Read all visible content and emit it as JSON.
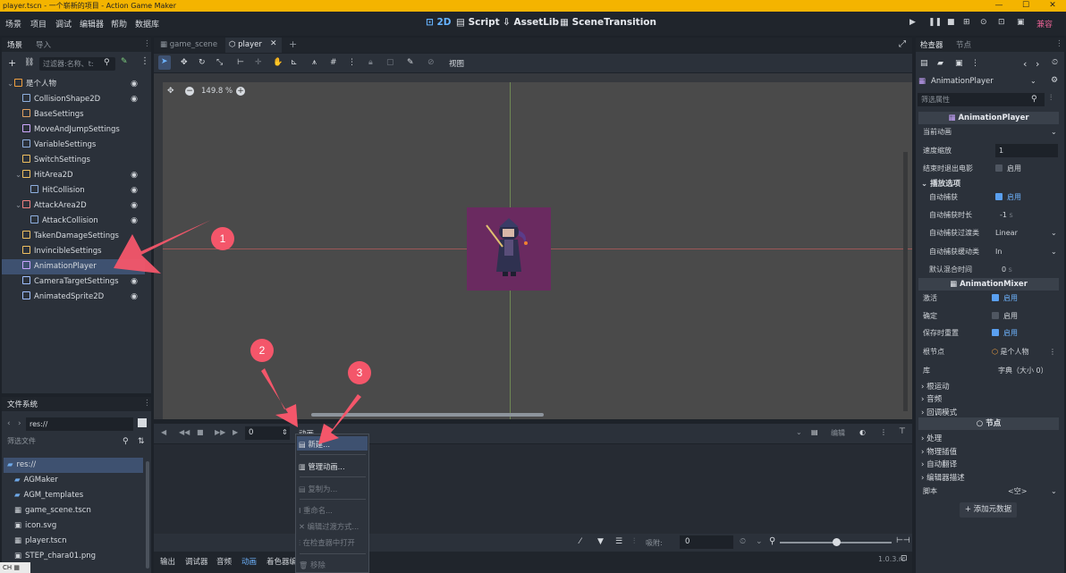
{
  "window": {
    "title": "player.tscn - 一个崭新的项目 - Action Game Maker"
  },
  "menu": {
    "items": [
      "场景",
      "项目",
      "调试",
      "编辑器",
      "帮助",
      "数据库"
    ]
  },
  "workspaces": {
    "2d": "2D",
    "script": "Script",
    "assetlib": "AssetLib",
    "scene_transition": "SceneTransition"
  },
  "renderer": "兼容",
  "scene_dock": {
    "tabs": [
      "场景",
      "导入"
    ],
    "filter_placeholder": "过滤器:名称、t:",
    "tree": [
      {
        "label": "是个人物",
        "depth": 0,
        "eye": true
      },
      {
        "label": "CollisionShape2D",
        "depth": 1,
        "eye": true
      },
      {
        "label": "BaseSettings",
        "depth": 1,
        "eye": false
      },
      {
        "label": "MoveAndJumpSettings",
        "depth": 1,
        "eye": false
      },
      {
        "label": "VariableSettings",
        "depth": 1,
        "eye": false
      },
      {
        "label": "SwitchSettings",
        "depth": 1,
        "eye": false
      },
      {
        "label": "HitArea2D",
        "depth": 1,
        "eye": true
      },
      {
        "label": "HitCollision",
        "depth": 2,
        "eye": true
      },
      {
        "label": "AttackArea2D",
        "depth": 1,
        "eye": true
      },
      {
        "label": "AttackCollision",
        "depth": 2,
        "eye": true
      },
      {
        "label": "TakenDamageSettings",
        "depth": 1,
        "eye": false
      },
      {
        "label": "InvincibleSettings",
        "depth": 1,
        "eye": false
      },
      {
        "label": "AnimationPlayer",
        "depth": 1,
        "eye": false,
        "selected": true
      },
      {
        "label": "CameraTargetSettings",
        "depth": 1,
        "eye": true
      },
      {
        "label": "AnimatedSprite2D",
        "depth": 1,
        "eye": true
      }
    ]
  },
  "filesystem": {
    "tab": "文件系统",
    "path": "res://",
    "filter_placeholder": "筛选文件",
    "items": [
      {
        "label": "res://",
        "depth": 0,
        "selected": true
      },
      {
        "label": "AGMaker",
        "depth": 1
      },
      {
        "label": "AGM_templates",
        "depth": 1
      },
      {
        "label": "game_scene.tscn",
        "depth": 1
      },
      {
        "label": "icon.svg",
        "depth": 1
      },
      {
        "label": "player.tscn",
        "depth": 1
      },
      {
        "label": "STEP_chara01.png",
        "depth": 1
      }
    ]
  },
  "editor_tabs": [
    "game_scene",
    "player"
  ],
  "viewport": {
    "zoom": "149.8 %",
    "view_label": "视图"
  },
  "animation_panel": {
    "frame": "0",
    "title": "动画",
    "edit": "编辑",
    "snap_label": "吸附:",
    "snap_value": "0"
  },
  "popup_menu": [
    {
      "label": "新建...",
      "enabled": true
    },
    {
      "label": "管理动画...",
      "enabled": true
    },
    {
      "label": "复制为...",
      "enabled": false
    },
    {
      "label": "重命名...",
      "enabled": false
    },
    {
      "label": "编辑过渡方式...",
      "enabled": false
    },
    {
      "label": "在检查器中打开",
      "enabled": false
    },
    {
      "label": "移除",
      "enabled": false
    }
  ],
  "bottom_tabs": [
    "输出",
    "调试器",
    "音频",
    "动画",
    "着色器编"
  ],
  "version": "1.0.3.rc",
  "inspector": {
    "tabs": [
      "检查器",
      "节点"
    ],
    "node_name": "AnimationPlayer",
    "filter_placeholder": "筛选属性",
    "section_player": "AnimationPlayer",
    "current_animation": "当前动画",
    "speed_scale_label": "速度缩放",
    "speed_scale_value": "1",
    "movie_quit_label": "结束时退出电影",
    "enable": "启用",
    "playback_group": "播放选项",
    "auto_capture_label": "自动捕获",
    "auto_capture_duration_label": "自动捕获时长",
    "auto_capture_duration_value": "-1",
    "unit_s": "s",
    "auto_capture_transition_label": "自动捕获过渡类",
    "auto_capture_transition_value": "Linear",
    "auto_capture_ease_label": "自动捕获缓动类",
    "auto_capture_ease_value": "In",
    "default_blend_label": "默认混合时间",
    "default_blend_value": "0",
    "section_mixer": "AnimationMixer",
    "active_label": "激活",
    "deterministic_label": "确定",
    "reset_on_save_label": "保存时重置",
    "root_node_label": "根节点",
    "root_node_value": "是个人物",
    "library_label": "库",
    "library_value": "字典（大小 0）",
    "groups": [
      "根运动",
      "音频",
      "回调模式"
    ],
    "node_section": "节点",
    "node_groups": [
      "处理",
      "物理插值",
      "自动翻译",
      "编辑器描述"
    ],
    "script_label": "脚本",
    "script_value": "<空>",
    "add_metadata": "添加元数据"
  },
  "annotations": [
    "1",
    "2",
    "3"
  ],
  "taskbar": {
    "ime": "CH"
  }
}
